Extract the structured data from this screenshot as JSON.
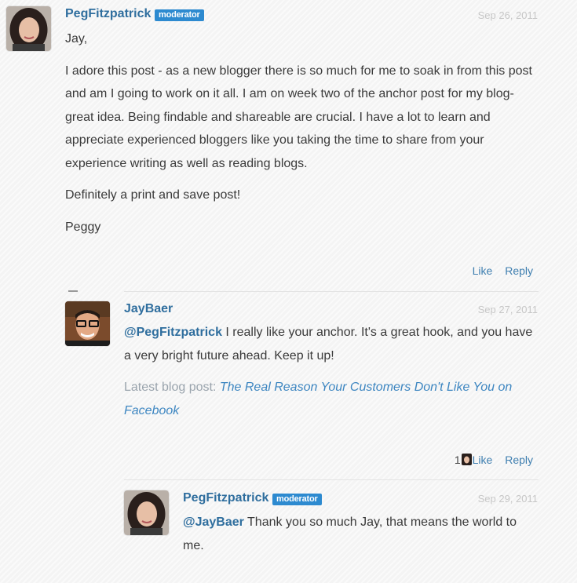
{
  "comments": [
    {
      "author": "PegFitzpatrick",
      "badge": "moderator",
      "date": "Sep 26, 2011",
      "paragraphs": [
        "Jay,",
        "I adore this post - as a new blogger there is so much for me to soak in from this post and am I going to work on it all. I am on week two of the anchor post for my blog- great idea. Being findable and shareable are crucial. I have a lot to learn and appreciate experienced bloggers like you taking the time to share from your experience writing as well as reading blogs.",
        "Definitely a print and save post!",
        "Peggy"
      ],
      "like_label": "Like",
      "reply_label": "Reply"
    },
    {
      "author": "JayBaer",
      "date": "Sep 27, 2011",
      "mention": "@PegFitzpatrick",
      "text": " I really like your anchor. It's a great hook, and you have a very bright future ahead. Keep it up!",
      "blog_label": "Latest blog post: ",
      "blog_link": "The Real Reason Your Customers Don't Like You on Facebook",
      "like_count": "1",
      "like_label": "Like",
      "reply_label": "Reply"
    },
    {
      "author": "PegFitzpatrick",
      "badge": "moderator",
      "date": "Sep 29, 2011",
      "mention": "@JayBaer",
      "text": " Thank you so much Jay, that means the world to me."
    }
  ]
}
